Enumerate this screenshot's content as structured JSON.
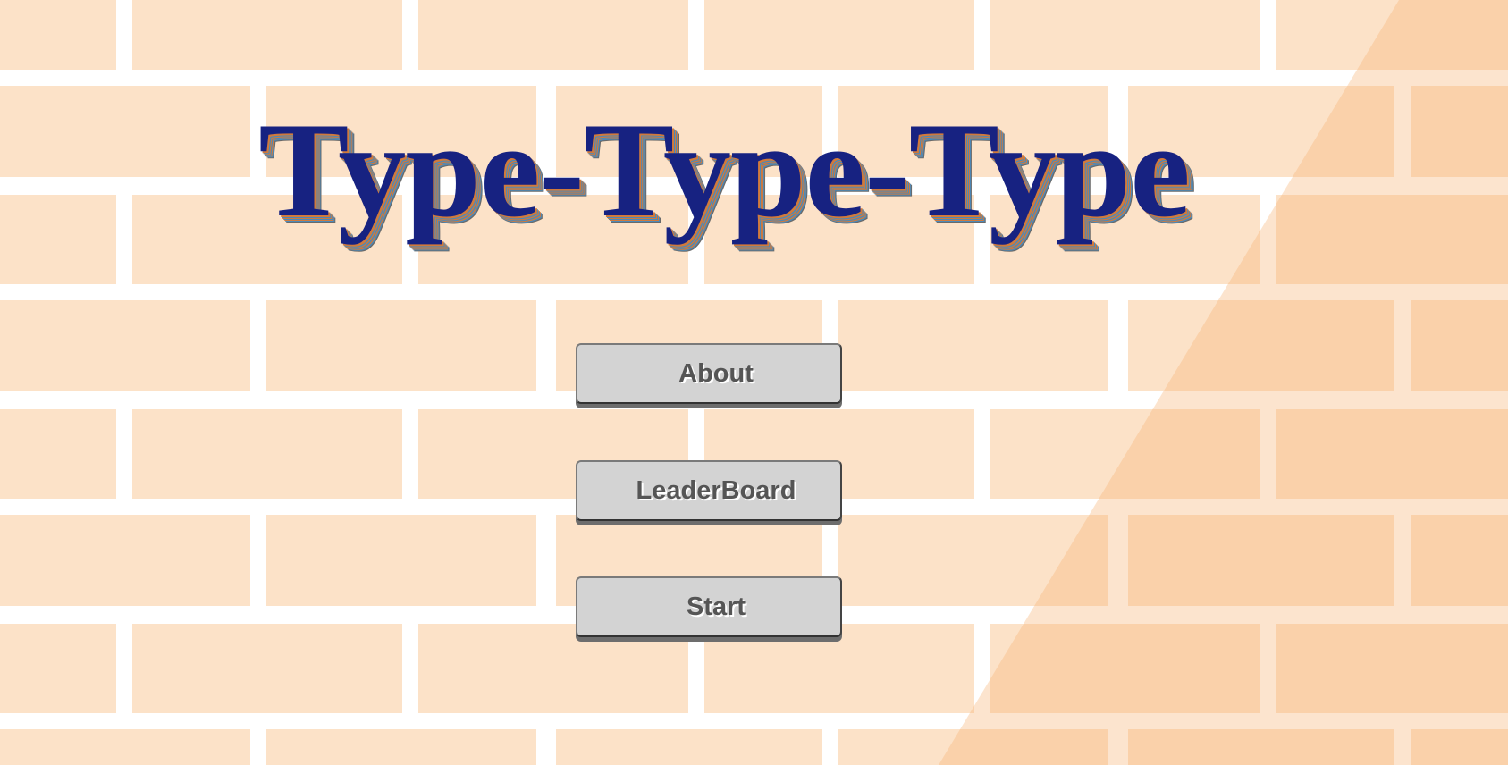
{
  "title": "Type-Type-Type",
  "menu": {
    "about_label": "About",
    "leaderboard_label": "LeaderBoard",
    "start_label": "Start"
  },
  "colors": {
    "brick": "#fce2c8",
    "mortar": "#ffffff",
    "overlay": "#f9c08a",
    "title": "#172281",
    "button": "#d3d3d3"
  }
}
